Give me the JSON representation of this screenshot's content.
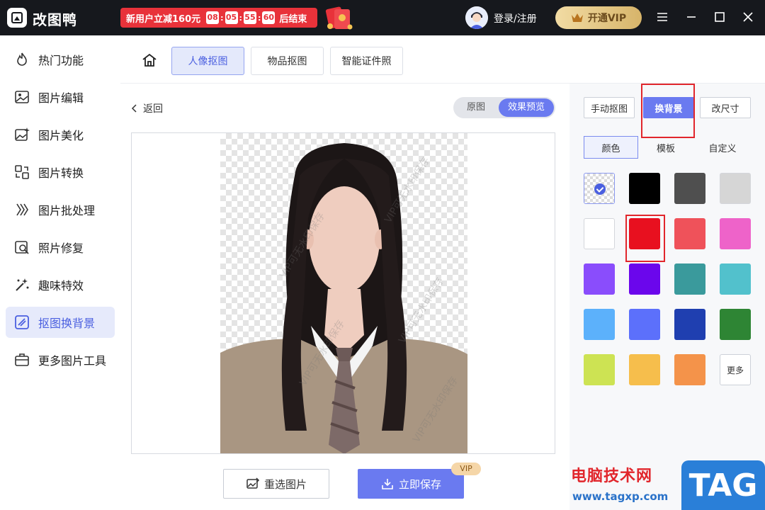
{
  "app": {
    "title": "改图鸭",
    "login": "登录/注册",
    "vip_button": "开通VIP"
  },
  "promo": {
    "text": "新用户立减160元",
    "timer": [
      "08",
      "05",
      "55",
      "60"
    ],
    "end_text": "后结束"
  },
  "sidebar": {
    "items": [
      {
        "label": "热门功能",
        "icon": "flame-icon"
      },
      {
        "label": "图片编辑",
        "icon": "image-edit-icon"
      },
      {
        "label": "图片美化",
        "icon": "sparkle-image-icon"
      },
      {
        "label": "图片转换",
        "icon": "convert-icon"
      },
      {
        "label": "图片批处理",
        "icon": "batch-icon"
      },
      {
        "label": "照片修复",
        "icon": "repair-icon"
      },
      {
        "label": "趣味特效",
        "icon": "magic-wand-icon"
      },
      {
        "label": "抠图换背景",
        "icon": "cutout-icon",
        "active": true
      },
      {
        "label": "更多图片工具",
        "icon": "toolbox-icon"
      }
    ]
  },
  "tabs": [
    {
      "label": "人像抠图",
      "active": true
    },
    {
      "label": "物品抠图"
    },
    {
      "label": "智能证件照"
    }
  ],
  "workspace": {
    "back": "返回",
    "toggle": {
      "original": "原图",
      "preview": "效果预览",
      "selected": "preview"
    },
    "watermark": "VIP可无水印保存",
    "reselect": "重选图片",
    "save": "立即保存",
    "vip_tag": "VIP"
  },
  "panel": {
    "buttons": [
      {
        "label": "手动抠图"
      },
      {
        "label": "换背景",
        "active": true
      },
      {
        "label": "改尺寸"
      }
    ],
    "subtabs": [
      {
        "label": "颜色",
        "active": true
      },
      {
        "label": "模板"
      },
      {
        "label": "自定义"
      }
    ],
    "swatches": [
      "transparent",
      "#000000",
      "#4f4f4f",
      "#d6d6d6",
      "#ffffff",
      "#e8101f",
      "#ef525a",
      "#ee63c9",
      "#8a4dfc",
      "#6b06ec",
      "#3a9a9c",
      "#52c1cc",
      "#5cb1fb",
      "#5c70fb",
      "#1f3fb0",
      "#2e8534",
      "#cde353",
      "#f6be4c",
      "#f4934a",
      "more"
    ],
    "more_label": "更多",
    "selected_swatch": 0
  },
  "branding": {
    "name": "电脑技术网",
    "url": "www.tagxp.com",
    "tag": "TAG"
  },
  "colors": {
    "accent": "#6a7af0",
    "highlight": "#e1262c",
    "titlebar": "#16181d"
  }
}
